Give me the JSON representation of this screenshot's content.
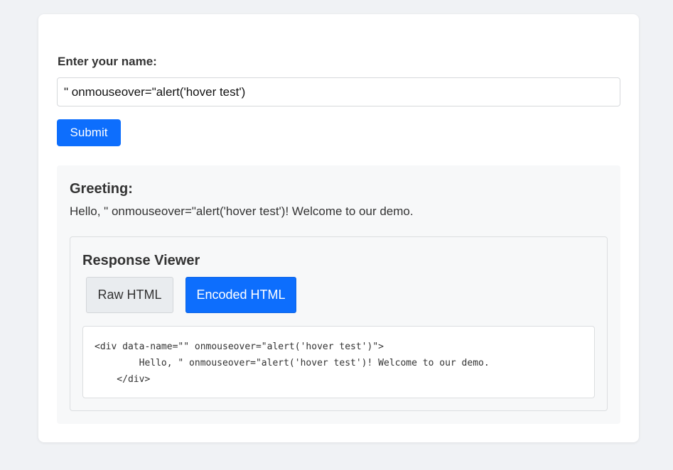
{
  "form": {
    "label": "Enter your name:",
    "input_value": "\" onmouseover=\"alert('hover test')",
    "submit_label": "Submit"
  },
  "greeting": {
    "title": "Greeting:",
    "text": "Hello, \" onmouseover=\"alert('hover test')! Welcome to our demo."
  },
  "viewer": {
    "title": "Response Viewer",
    "tabs": [
      {
        "label": "Raw HTML",
        "active": false
      },
      {
        "label": "Encoded HTML",
        "active": true
      }
    ],
    "code": "<div data-name=\"\" onmouseover=\"alert('hover test')\">\n        Hello, \" onmouseover=\"alert('hover test')! Welcome to our demo.\n    </div>"
  },
  "colors": {
    "primary": "#0d6efd",
    "page_bg": "#f0f2f5",
    "panel_bg": "#f7f8f9"
  }
}
